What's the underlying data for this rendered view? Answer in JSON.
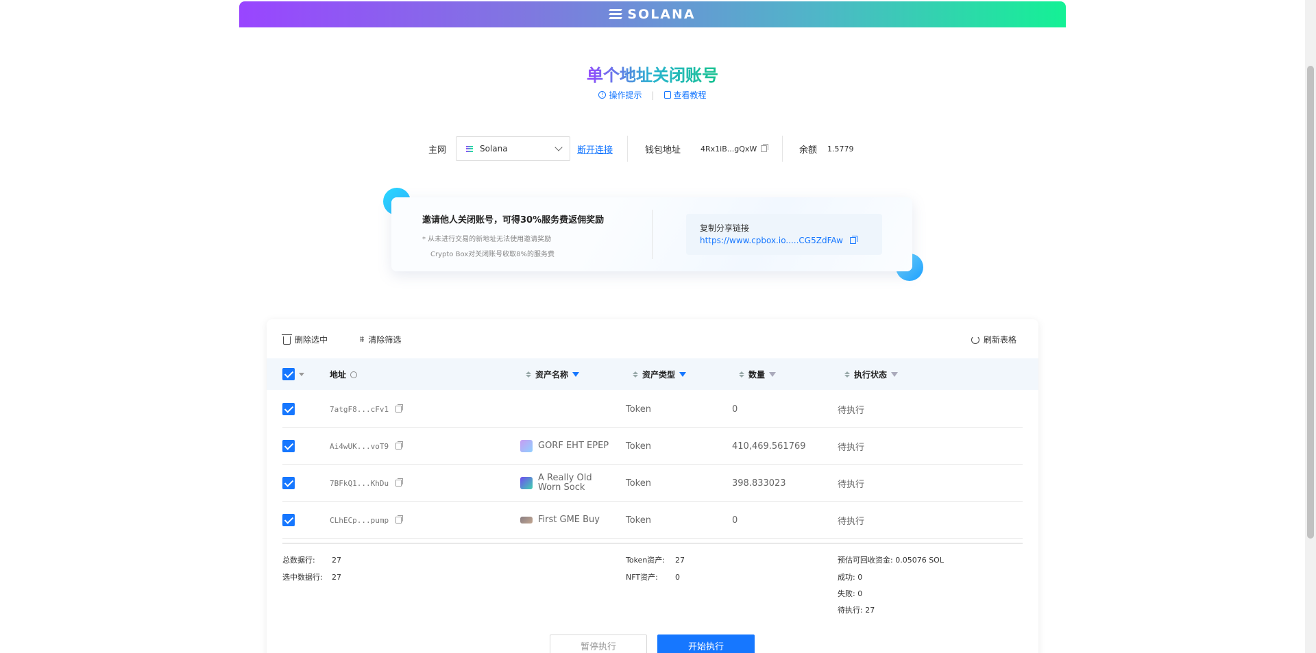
{
  "brand": {
    "logo_text": "SOLANA",
    "banner_gradient": [
      "#9945ff",
      "#14f195"
    ]
  },
  "title": "单个地址关闭账号",
  "sublinks": {
    "tips": "操作提示",
    "tutorial": "查看教程"
  },
  "network": {
    "label": "主网",
    "selected": "Solana",
    "disconnect": "断开连接",
    "wallet_label": "钱包地址",
    "wallet_value": "4Rx1iB...gQxW",
    "balance_label": "余额",
    "balance_value": "1.5779"
  },
  "invite": {
    "title": "邀请他人关闭账号，可得30%服务费返佣奖励",
    "note1": "*  从未进行交易的新地址无法使用邀请奖励",
    "note2": "Crypto Box对关闭账号收取8%的服务费",
    "share_label": "复制分享链接",
    "share_link": "https://www.cpbox.io.....CG5ZdFAw"
  },
  "toolbar": {
    "delete_selected": "删除选中",
    "clear_filter": "清除筛选",
    "refresh": "刷新表格"
  },
  "table": {
    "headers": {
      "address": "地址",
      "asset_name": "资产名称",
      "asset_type": "资产类型",
      "amount": "数量",
      "status": "执行状态"
    },
    "rows": [
      {
        "address": "7atgF8...cFv1",
        "asset_name": "",
        "asset_type": "Token",
        "amount": "0",
        "status": "待执行"
      },
      {
        "address": "Ai4wUK...voT9",
        "asset_name": "GORF EHT EPEP",
        "asset_type": "Token",
        "amount": "410,469.561769",
        "status": "待执行"
      },
      {
        "address": "7BFkQ1...KhDu",
        "asset_name": "A Really Old Worn Sock",
        "asset_type": "Token",
        "amount": "398.833023",
        "status": "待执行"
      },
      {
        "address": "CLhECp...pump",
        "asset_name": "First GME Buy",
        "asset_type": "Token",
        "amount": "0",
        "status": "待执行"
      }
    ]
  },
  "stats": {
    "total_label": "总数据行:",
    "total_value": "27",
    "selected_label": "选中数据行:",
    "selected_value": "27",
    "token_label": "Token资产:",
    "token_value": "27",
    "nft_label": "NFT资产:",
    "nft_value": "0",
    "recover_label": "预估可回收资金:",
    "recover_value": "0.05076 SOL",
    "success_label": "成功:",
    "success_value": "0",
    "fail_label": "失败:",
    "fail_value": "0",
    "pending_label": "待执行:",
    "pending_value": "27"
  },
  "actions": {
    "pause": "暂停执行",
    "start": "开始执行"
  },
  "colors": {
    "accent": "#1677ff"
  }
}
